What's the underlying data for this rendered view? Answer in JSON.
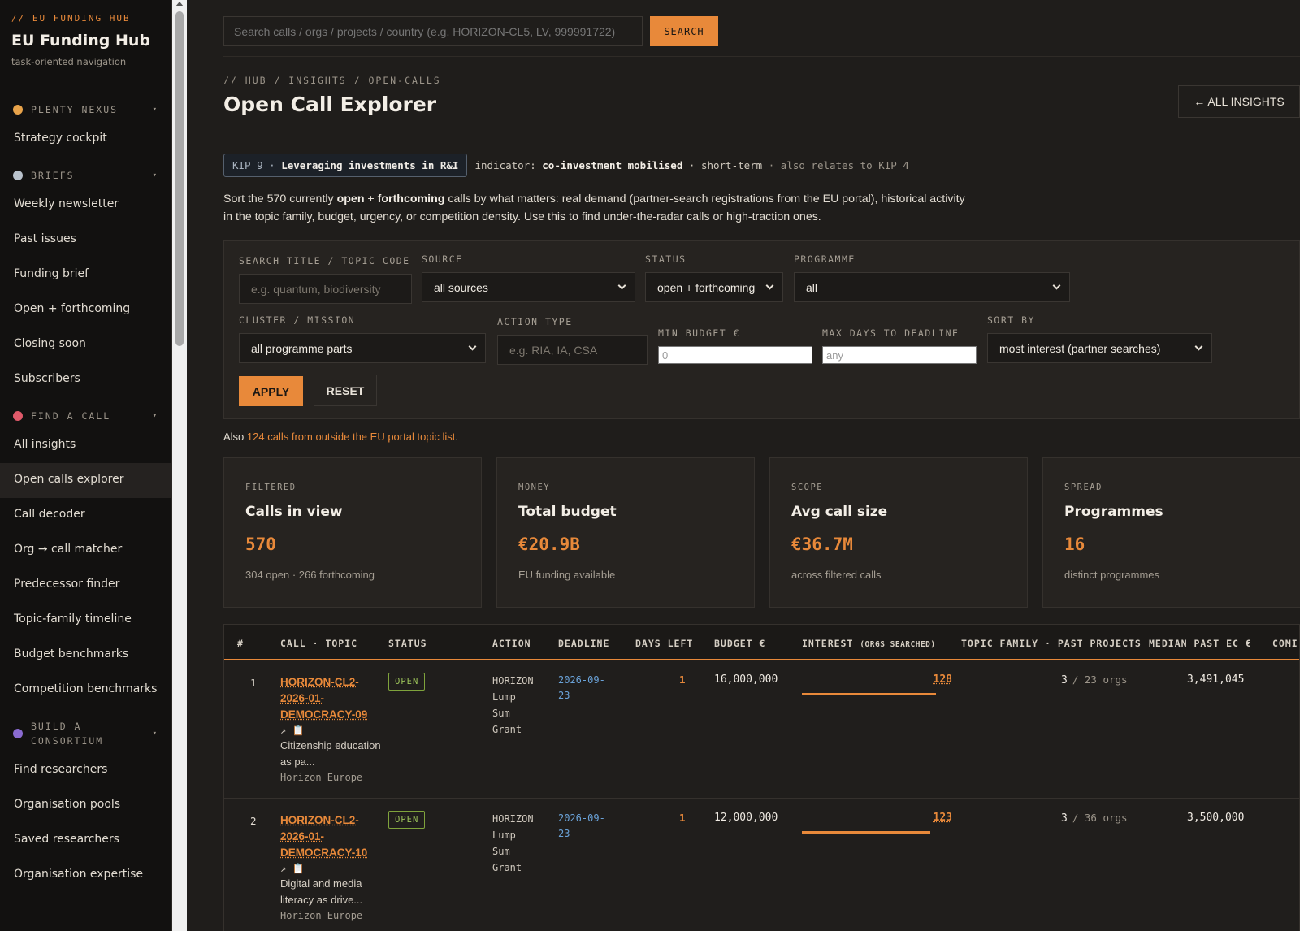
{
  "sidebar": {
    "kicker": "// EU FUNDING HUB",
    "title": "EU Funding Hub",
    "subtitle": "task-oriented navigation",
    "groups": [
      {
        "label": "PLENTY NEXUS",
        "icon": "clock-icon",
        "items": [
          "Strategy cockpit"
        ]
      },
      {
        "label": "BRIEFS",
        "icon": "newspaper-icon",
        "items": [
          "Weekly newsletter",
          "Past issues",
          "Funding brief",
          "Open + forthcoming",
          "Closing soon",
          "Subscribers"
        ]
      },
      {
        "label": "FIND A CALL",
        "icon": "target-icon",
        "items": [
          "All insights",
          "Open calls explorer",
          "Call decoder",
          "Org → call matcher",
          "Predecessor finder",
          "Topic-family timeline",
          "Budget benchmarks",
          "Competition benchmarks"
        ]
      },
      {
        "label": "BUILD A CONSORTIUM",
        "icon": "people-icon",
        "items": [
          "Find researchers",
          "Organisation pools",
          "Saved researchers",
          "Organisation expertise"
        ]
      }
    ],
    "active_item": "Open calls explorer"
  },
  "topbar": {
    "search_placeholder": "Search calls / orgs / projects / country (e.g. HORIZON-CL5, LV, 999991722)",
    "search_label": "SEARCH"
  },
  "page": {
    "breadcrumb": "// HUB / INSIGHTS / OPEN-CALLS",
    "title": "Open Call Explorer",
    "back_label": "← ALL INSIGHTS",
    "kip": {
      "code": "KIP 9 ·",
      "name": "Leveraging investments in R&I",
      "indicator_label": "indicator:",
      "indicator": "co-investment mobilised",
      "term": "· short-term",
      "relates": "· also relates to KIP 4"
    },
    "intro_1": "Sort the 570 currently ",
    "intro_b1": "open",
    "intro_2": " + ",
    "intro_b2": "forthcoming",
    "intro_3": " calls by what matters: real demand (partner-search registrations from the EU portal), historical activity in the topic family, budget, urgency, or competition density. Use this to find under-the-radar calls or high-traction ones."
  },
  "filters": {
    "search_label": "SEARCH TITLE / TOPIC CODE",
    "search_placeholder": "e.g. quantum, biodiversity",
    "source_label": "SOURCE",
    "source_value": "all sources",
    "status_label": "STATUS",
    "status_value": "open + forthcoming",
    "programme_label": "PROGRAMME",
    "programme_value": "all",
    "cluster_label": "CLUSTER / MISSION",
    "cluster_value": "all programme parts",
    "action_label": "ACTION TYPE",
    "action_placeholder": "e.g. RIA, IA, CSA",
    "min_budget_label": "MIN BUDGET €",
    "min_budget_placeholder": "0",
    "max_days_label": "MAX DAYS TO DEADLINE",
    "max_days_placeholder": "any",
    "sort_label": "SORT BY",
    "sort_value": "most interest (partner searches)",
    "apply_label": "APPLY",
    "reset_label": "RESET"
  },
  "also": {
    "prefix": "Also ",
    "link": "124 calls from outside the EU portal topic list",
    "suffix": "."
  },
  "cards": [
    {
      "kicker": "FILTERED",
      "title": "Calls in view",
      "value": "570",
      "sub": "304 open · 266 forthcoming"
    },
    {
      "kicker": "MONEY",
      "title": "Total budget",
      "value": "€20.9B",
      "sub": "EU funding available"
    },
    {
      "kicker": "SCOPE",
      "title": "Avg call size",
      "value": "€36.7M",
      "sub": "across filtered calls"
    },
    {
      "kicker": "SPREAD",
      "title": "Programmes",
      "value": "16",
      "sub": "distinct programmes"
    }
  ],
  "table": {
    "headers": {
      "num": "#",
      "call": "CALL · TOPIC",
      "status": "STATUS",
      "action": "ACTION",
      "deadline": "DEADLINE",
      "days": "DAYS LEFT",
      "budget": "BUDGET €",
      "interest": "INTEREST",
      "interest_sub": "(ORGS SEARCHED)",
      "family": "TOPIC FAMILY · PAST PROJECTS",
      "median": "MEDIAN PAST EC €",
      "comp": "COMI"
    },
    "rows": [
      {
        "num": "1",
        "code": "HORIZON-CL2-2026-01-DEMOCRACY-09",
        "icons": "↗ 📋",
        "title": "Citizenship education as pa...",
        "programme": "Horizon Europe",
        "status": "OPEN",
        "action": [
          "HORIZON",
          "Lump",
          "Sum",
          "Grant"
        ],
        "deadline": [
          "2026-09-",
          "23"
        ],
        "days": "1",
        "budget": "16,000,000",
        "interest": "128",
        "interest_frac": 1.0,
        "family_n": "3",
        "family_orgs": "/ 23 orgs",
        "median": "3,491,045"
      },
      {
        "num": "2",
        "code": "HORIZON-CL2-2026-01-DEMOCRACY-10",
        "icons": "↗ 📋",
        "title": "Digital and media literacy as drive...",
        "programme": "Horizon Europe",
        "status": "OPEN",
        "action": [
          "HORIZON",
          "Lump",
          "Sum",
          "Grant"
        ],
        "deadline": [
          "2026-09-",
          "23"
        ],
        "days": "1",
        "budget": "12,000,000",
        "interest": "123",
        "interest_frac": 0.96,
        "family_n": "3",
        "family_orgs": "/ 36 orgs",
        "median": "3,500,000"
      }
    ]
  },
  "colors": {
    "accent": "#e8893a",
    "open_status": "#9cc35a",
    "deadline": "#6aa2d8",
    "bg": "#1f1d1b"
  }
}
